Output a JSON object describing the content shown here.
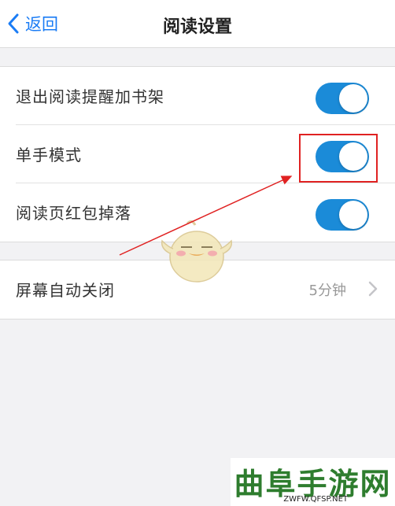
{
  "nav": {
    "back_label": "返回",
    "title": "阅读设置"
  },
  "settings": [
    {
      "label": "退出阅读提醒加书架",
      "toggle": "on"
    },
    {
      "label": "单手模式",
      "toggle": "on"
    },
    {
      "label": "阅读页红包掉落",
      "toggle": "on"
    }
  ],
  "screen_off": {
    "label": "屏幕自动关闭",
    "value": "5分钟"
  },
  "colors": {
    "accent": "#1a7cf5",
    "toggle_on": "#1b8bd8",
    "highlight": "#e02222",
    "watermark": "#2e7d2e"
  },
  "watermark": {
    "title": "曲阜手游网",
    "url": "ZWFW.QFSP.NET"
  }
}
